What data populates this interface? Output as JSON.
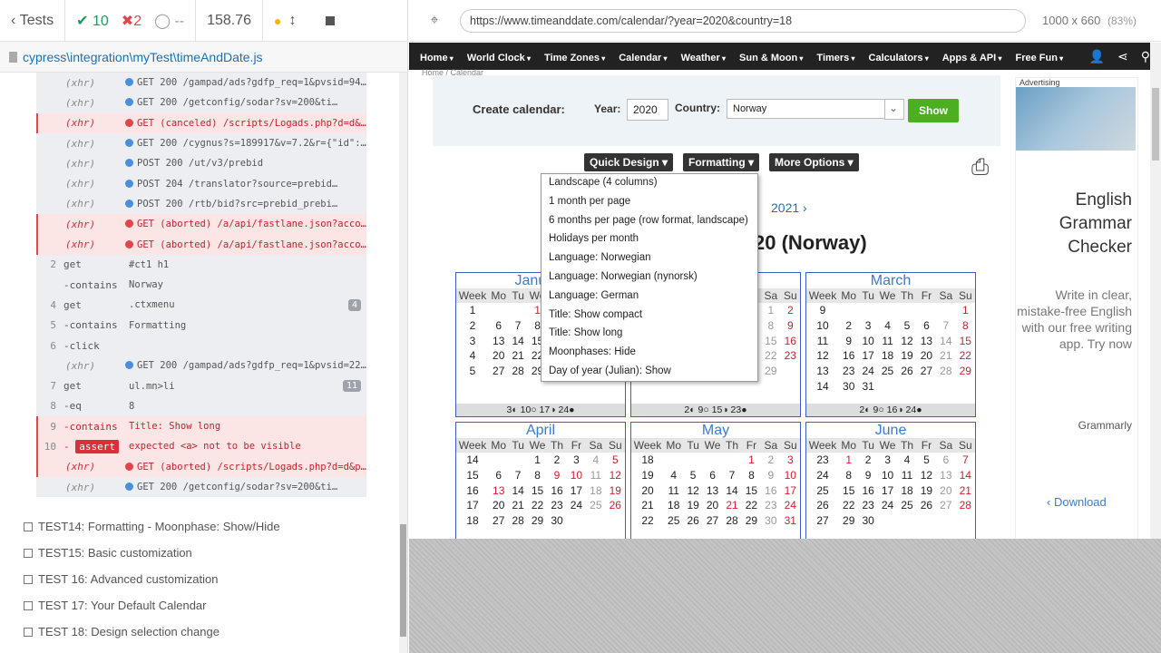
{
  "runner": {
    "tests_label": "Tests",
    "passed": "10",
    "failed": "2",
    "pending": "--",
    "duration": "158.76",
    "spec_path": "cypress\\integration\\myTest\\timeAndDate.js",
    "commands": [
      {
        "kind": "xhr",
        "err": false,
        "dot": "blue",
        "text": "GET 200 /gampad/ads?gdfp_req=1&pvsid=943…"
      },
      {
        "kind": "xhr",
        "err": false,
        "dot": "blue",
        "text": "GET 200 /getconfig/sodar?sv=200&ti…"
      },
      {
        "kind": "xhr",
        "err": true,
        "dot": "red",
        "text": "GET (canceled) /scripts/Logads.php?d=d&p…"
      },
      {
        "kind": "xhr",
        "err": false,
        "dot": "blue",
        "text": "GET 200 /cygnus?s=189917&v=7.2&r={\"id\":\"…"
      },
      {
        "kind": "xhr",
        "err": false,
        "dot": "blue",
        "text": "POST 200 /ut/v3/prebid"
      },
      {
        "kind": "xhr",
        "err": false,
        "dot": "blue",
        "text": "POST 204 /translator?source=prebid…"
      },
      {
        "kind": "xhr",
        "err": false,
        "dot": "blue",
        "text": "POST 200 /rtb/bid?src=prebid_prebi…"
      },
      {
        "kind": "xhr",
        "err": true,
        "dot": "red",
        "text": "GET (aborted) /a/api/fastlane.json?accou…"
      },
      {
        "kind": "xhr",
        "err": true,
        "dot": "red",
        "text": "GET (aborted) /a/api/fastlane.json?accou…"
      },
      {
        "kind": "cmd",
        "err": false,
        "num": "2",
        "cmd": "get",
        "text": "#ct1 h1"
      },
      {
        "kind": "cmd",
        "err": false,
        "num": "",
        "cmd": "-contains",
        "text": "Norway"
      },
      {
        "kind": "cmd",
        "err": false,
        "num": "4",
        "cmd": "get",
        "text": ".ctxmenu",
        "badge": "4"
      },
      {
        "kind": "cmd",
        "err": false,
        "num": "5",
        "cmd": "-contains",
        "text": "Formatting"
      },
      {
        "kind": "cmd",
        "err": false,
        "num": "6",
        "cmd": "-click",
        "text": ""
      },
      {
        "kind": "xhr",
        "err": false,
        "dot": "blue",
        "text": "GET 200 /gampad/ads?gdfp_req=1&pvsid=223…"
      },
      {
        "kind": "cmd",
        "err": false,
        "num": "7",
        "cmd": "get",
        "text": "ul.mn>li",
        "badge": "11"
      },
      {
        "kind": "cmd",
        "err": false,
        "num": "8",
        "cmd": "-eq",
        "text": "8"
      },
      {
        "kind": "cmd",
        "err": true,
        "num": "9",
        "cmd": "-contains",
        "text": "Title: Show long"
      },
      {
        "kind": "assert",
        "err": true,
        "num": "10",
        "cmd": "assert",
        "text": "expected <a> not to be visible"
      },
      {
        "kind": "xhr",
        "err": true,
        "dot": "red",
        "text": "GET (aborted) /scripts/Logads.php?d=d&p0…"
      },
      {
        "kind": "xhr",
        "err": false,
        "dot": "blue",
        "text": "GET 200 /getconfig/sodar?sv=200&ti…"
      }
    ],
    "xhr_label": "(xhr)",
    "tests": [
      "TEST14: Formatting - Moonphase: Show/Hide",
      "TEST15: Basic customization",
      "TEST 16: Advanced customization",
      "TEST 17: Your Default Calendar",
      "TEST 18: Design selection change"
    ]
  },
  "aut": {
    "url": "https://www.timeanddate.com/calendar/?year=2020&country=18",
    "viewport": "1000 x 660",
    "zoom": "(83%)"
  },
  "site": {
    "nav": [
      "Home",
      "World Clock",
      "Time Zones",
      "Calendar",
      "Weather",
      "Sun & Moon",
      "Timers",
      "Calculators",
      "Apps & API",
      "Free Fun"
    ],
    "crumb": "Home / Calendar",
    "create_label": "Create calendar:",
    "year_label": "Year:",
    "year_value": "2020",
    "country_label": "Country:",
    "country_value": "Norway",
    "show_btn": "Show",
    "quick_design": "Quick Design",
    "formatting": "Formatting",
    "more_options": "More Options",
    "menu": [
      "Landscape (4 columns)",
      "1 month per page",
      "6 months per page (row format, landscape)",
      "Holidays per month",
      "Language: Norwegian",
      "Language: Norwegian (nynorsk)",
      "Language: German",
      "Title: Show compact",
      "Title: Show long",
      "Moonphases: Hide",
      "Day of year (Julian): Show"
    ],
    "next_year": "2021",
    "cal_title": "20 (Norway)",
    "week_hdr": [
      "Week",
      "Mo",
      "Tu",
      "We",
      "Th",
      "Fr",
      "Sa",
      "Su"
    ],
    "ad": {
      "advertising": "Advertising",
      "headline": "English Grammar Checker",
      "body": "Write in clear, mistake-free English with our free writing app. Try now",
      "brand": "Grammarly",
      "download": "Download"
    }
  }
}
